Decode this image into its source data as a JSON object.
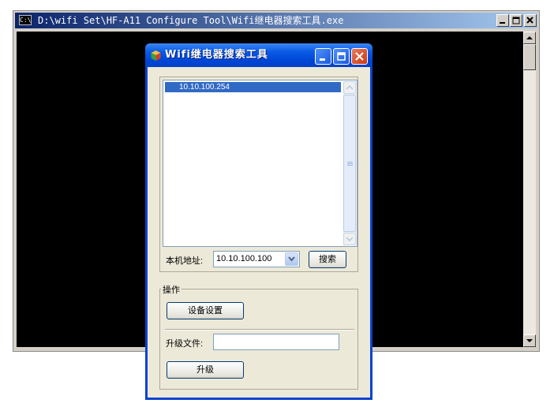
{
  "console": {
    "title": "D:\\wifi Set\\HF-A11 Configure Tool\\Wifi继电器搜索工具.exe",
    "icon_text": "C:\\"
  },
  "dialog": {
    "title": "Wifi继电器搜索工具",
    "device_list": [
      "10.10.100.254"
    ],
    "local_address_label": "本机地址:",
    "local_address_value": "10.10.100.100",
    "search_button": "搜索",
    "operations_legend": "操作",
    "device_settings_button": "设备设置",
    "upgrade_file_label": "升级文件:",
    "upgrade_file_value": "",
    "upgrade_button": "升级"
  },
  "colors": {
    "console_title": "#0a246a",
    "dialog_title": "#0054e3",
    "selection": "#316ac5"
  }
}
